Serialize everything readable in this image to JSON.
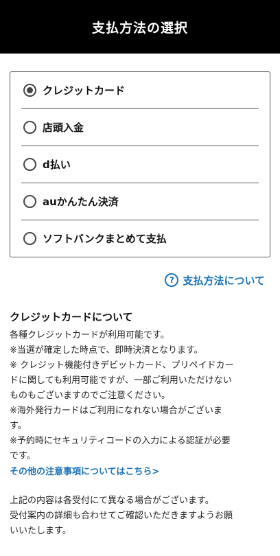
{
  "header": {
    "title": "支払方法の選択"
  },
  "methods": [
    {
      "label": "クレジットカード",
      "selected": true
    },
    {
      "label": "店頭入金",
      "selected": false
    },
    {
      "label": "d払い",
      "selected": false
    },
    {
      "label": "auかんたん決済",
      "selected": false
    },
    {
      "label": "ソフトバンクまとめて支払",
      "selected": false
    }
  ],
  "help": {
    "icon": "?",
    "label": "支払方法について"
  },
  "info": {
    "title": "クレジットカードについて",
    "lines": [
      "各種クレジットカードが利用可能です。",
      "※当選が確定した時点で、即時決済となります。",
      "※ クレジット機能付きデビットカード、プリペイドカー",
      "ドに関しても利用可能ですが、一部ご利用いただけない",
      "ものもございますのでご注意ください。",
      "※海外発行カードはご利用になれない場合がございま",
      "す。",
      "※予約時にセキュリティコードの入力による認証が必要",
      "です。"
    ],
    "more_link": "その他の注意事項についてはこちら>"
  },
  "note": {
    "lines": [
      "上記の内容は各受付にて異なる場合がございます。",
      "受付案内の詳細も合わせてご確認いただきますようお願",
      "いいたします。"
    ]
  },
  "colors": {
    "header_bg": "#000000",
    "link": "#1a73b8",
    "border": "#555555"
  }
}
